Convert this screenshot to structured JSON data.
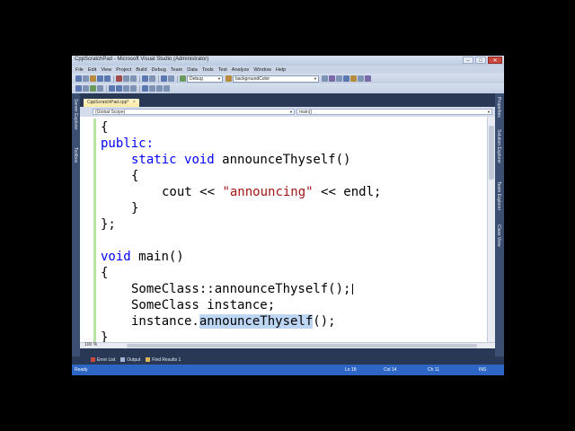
{
  "window": {
    "title": "CppScratchPad - Microsoft Visual Studio (Administrator)",
    "minimize": "–",
    "maximize": "□",
    "close": "✕"
  },
  "menu": [
    "File",
    "Edit",
    "View",
    "Project",
    "Build",
    "Debug",
    "Team",
    "Data",
    "Tools",
    "Test",
    "Analyze",
    "Window",
    "Help"
  ],
  "toolbar": {
    "config": "Debug",
    "find": "backgroundColor"
  },
  "side_panels": {
    "left": [
      "Server Explorer",
      "Toolbox"
    ],
    "right": [
      "Properties",
      "Solution Explorer",
      "Team Explorer",
      "Class View"
    ]
  },
  "editor_tab": {
    "label": "CppScratchPad.cpp*",
    "close": "×"
  },
  "navbar": {
    "scope": "(Global Scope)",
    "member": "main()"
  },
  "code": {
    "l1_brace": "{",
    "l2_public": "public:",
    "l3_static": "static",
    "l3_void": "void",
    "l3_name": "announceThyself()",
    "l4_brace": "{",
    "l5_cout": "cout << ",
    "l5_str": "\"announcing\"",
    "l5_endl": " << endl;",
    "l6_brace": "}",
    "l7_close": "};",
    "l8_void": "void",
    "l8_main": "main()",
    "l9_brace": "{",
    "l10_call": "SomeClass::announceThyself();",
    "l11_decl": "SomeClass instance;",
    "l12_prefix": "instance.",
    "l12_selected": "announceThyself",
    "l12_suffix": "();",
    "l13_brace": "}"
  },
  "zoom": "100 %",
  "bottom_tabs": [
    "Error List",
    "Output",
    "Find Results 1"
  ],
  "status": {
    "ready": "Ready",
    "ln": "Ln 18",
    "col": "Col 14",
    "ch": "Ch 11",
    "ins": "INS"
  }
}
